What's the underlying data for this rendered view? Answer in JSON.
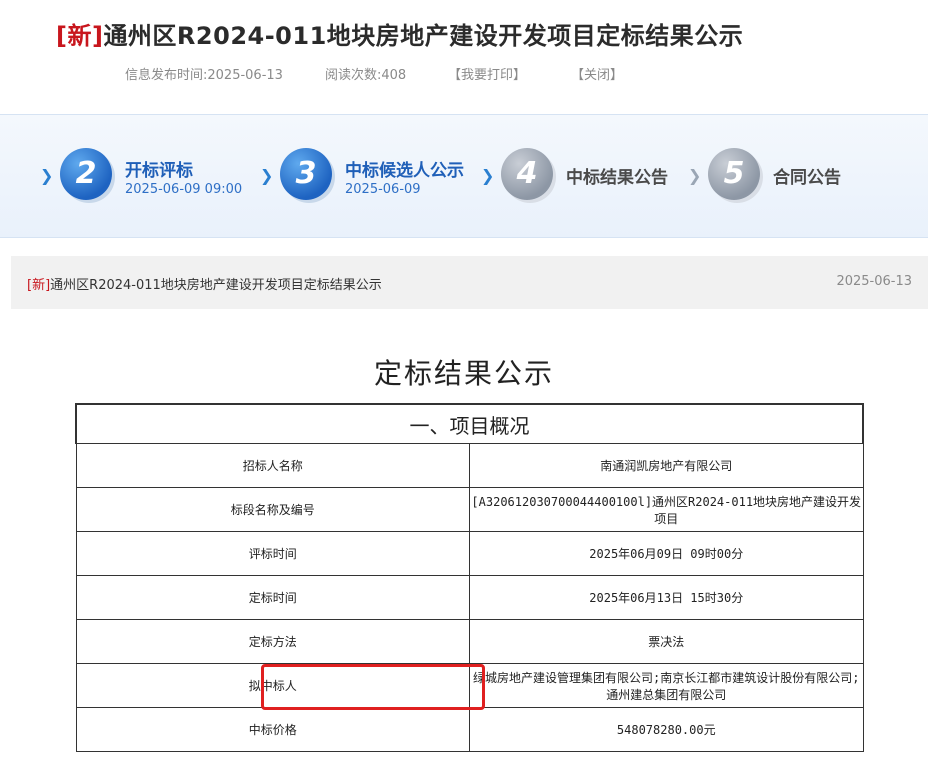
{
  "header": {
    "tag": "[新]",
    "title": "通州区R2024-011地块房地产建设开发项目定标结果公示",
    "publish_time": "信息发布时间:2025-06-13",
    "read_count": "阅读次数:408",
    "print_label": "【我要打印】",
    "close_label": "【关闭】"
  },
  "progress": {
    "steps": [
      {
        "number": "2",
        "label": "开标评标",
        "date": "2025-06-09 09:00",
        "active": true
      },
      {
        "number": "3",
        "label": "中标候选人公示",
        "date": "2025-06-09",
        "active": true
      },
      {
        "number": "4",
        "label": "中标结果公告",
        "date": "",
        "active": false
      },
      {
        "number": "5",
        "label": "合同公告",
        "date": "",
        "active": false
      }
    ]
  },
  "list_item": {
    "tag": "[新]",
    "title": "通州区R2024-011地块房地产建设开发项目定标结果公示",
    "date": "2025-06-13"
  },
  "document": {
    "title": "定标结果公示",
    "section_title": "一、项目概况",
    "rows": [
      {
        "label": "招标人名称",
        "value": "南通润凯房地产有限公司"
      },
      {
        "label": "标段名称及编号",
        "value": "[A320612030700044400100l]通州区R2024-011地块房地产建设开发项目"
      },
      {
        "label": "评标时间",
        "value": "2025年06月09日 09时00分"
      },
      {
        "label": "定标时间",
        "value": "2025年06月13日 15时30分"
      },
      {
        "label": "定标方法",
        "value": "票决法"
      },
      {
        "label": "拟中标人",
        "value": "绿城房地产建设管理集团有限公司;南京长江都市建筑设计股份有限公司;通州建总集团有限公司"
      },
      {
        "label": "中标价格",
        "value": "548078280.00元"
      }
    ]
  },
  "colors": {
    "tag_red": "#c8161d",
    "step_active": "#1f5fb8",
    "step_inactive": "#8d97a5",
    "highlight_red": "#e02020"
  }
}
